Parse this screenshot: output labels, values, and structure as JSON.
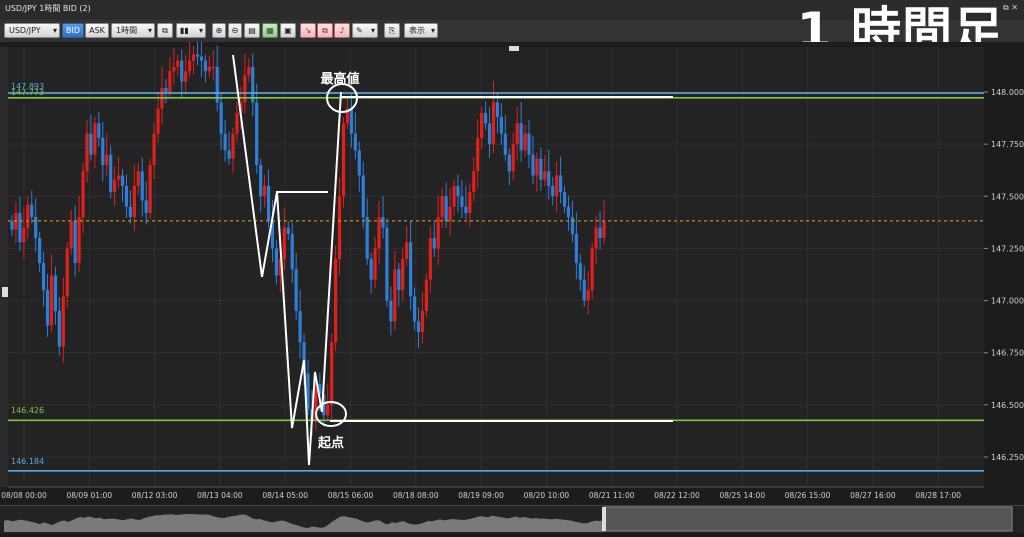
{
  "window": {
    "title": "USD/JPY 1時間 BID (2)",
    "window_controls": "⧉ ✕"
  },
  "caption": "1 時間足",
  "toolbar": {
    "symbol": "USD/JPY",
    "bid_label": "BID",
    "ask_label": "ASK",
    "timeframe": "1時間",
    "display_label": "表示"
  },
  "chart_data": {
    "type": "candlestick",
    "instrument": "USD/JPY",
    "price_axis": {
      "ticks": [
        "148.000",
        "147.750",
        "147.500",
        "147.250",
        "147.000",
        "146.750",
        "146.500",
        "146.250"
      ],
      "range": [
        146.09,
        148.17
      ]
    },
    "time_axis": {
      "ticks": [
        "08/08 00:00",
        "08/09 01:00",
        "08/12 03:00",
        "08/13 04:00",
        "08/14 05:00",
        "08/15 06:00",
        "08/18 08:00",
        "08/19 09:00",
        "08/20 10:00",
        "08/21 11:00",
        "08/22 12:00",
        "08/25 14:00",
        "08/26 15:00",
        "08/27 16:00",
        "08/28 17:00"
      ]
    },
    "current_price": {
      "label": "147.382",
      "value": 147.382,
      "color": "#f0a020"
    },
    "horizontal_lines": [
      {
        "label": "147.893",
        "value": 147.995,
        "color": "#5aa9e6"
      },
      {
        "label": "147.773",
        "value": 147.972,
        "color": "#7ac943"
      },
      {
        "label": "146.426",
        "value": 146.426,
        "color": "#7ac943"
      },
      {
        "label": "146.184",
        "value": 146.184,
        "color": "#5aa9e6"
      }
    ],
    "annotations": {
      "high_label": "最高値",
      "start_label": "起点"
    },
    "candle_colors": {
      "up": "#e0201c",
      "down": "#2f7fd8"
    },
    "close_series": [
      147.34,
      147.42,
      147.28,
      147.35,
      147.46,
      147.4,
      147.3,
      147.18,
      147.05,
      146.88,
      147.12,
      146.95,
      146.78,
      147.02,
      147.25,
      147.38,
      147.18,
      147.4,
      147.62,
      147.8,
      147.7,
      147.85,
      147.78,
      147.65,
      147.7,
      147.52,
      147.58,
      147.6,
      147.55,
      147.45,
      147.4,
      147.55,
      147.62,
      147.48,
      147.42,
      147.65,
      147.8,
      147.92,
      148.02,
      148.0,
      148.1,
      148.12,
      148.15,
      148.05,
      148.1,
      148.15,
      148.18,
      148.17,
      148.15,
      148.1,
      148.12,
      148.12,
      147.95,
      147.8,
      147.72,
      147.68,
      147.8,
      147.9,
      147.95,
      148.08,
      148.12,
      147.95,
      147.65,
      147.5,
      147.55,
      147.38,
      147.25,
      147.12,
      147.2,
      147.35,
      147.32,
      147.15,
      146.95,
      146.8,
      146.65,
      146.48,
      146.42,
      146.6,
      146.55,
      146.45,
      146.5,
      146.8,
      147.2,
      147.5,
      147.85,
      147.92,
      147.8,
      147.72,
      147.6,
      147.4,
      147.2,
      147.1,
      147.25,
      147.4,
      147.35,
      147.0,
      146.9,
      147.15,
      147.05,
      147.2,
      147.28,
      147.02,
      146.9,
      146.85,
      146.95,
      147.1,
      147.3,
      147.25,
      147.4,
      147.5,
      147.38,
      147.45,
      147.55,
      147.5,
      147.45,
      147.42,
      147.52,
      147.62,
      147.78,
      147.9,
      147.85,
      147.75,
      147.95,
      147.88,
      147.8,
      147.7,
      147.62,
      147.75,
      147.85,
      147.72,
      147.8,
      147.7,
      147.6,
      147.68,
      147.58,
      147.62,
      147.55,
      147.5,
      147.6,
      147.52,
      147.45,
      147.4,
      147.32,
      147.18,
      147.1,
      147.0,
      147.05,
      147.25,
      147.35,
      147.3,
      147.38
    ]
  }
}
